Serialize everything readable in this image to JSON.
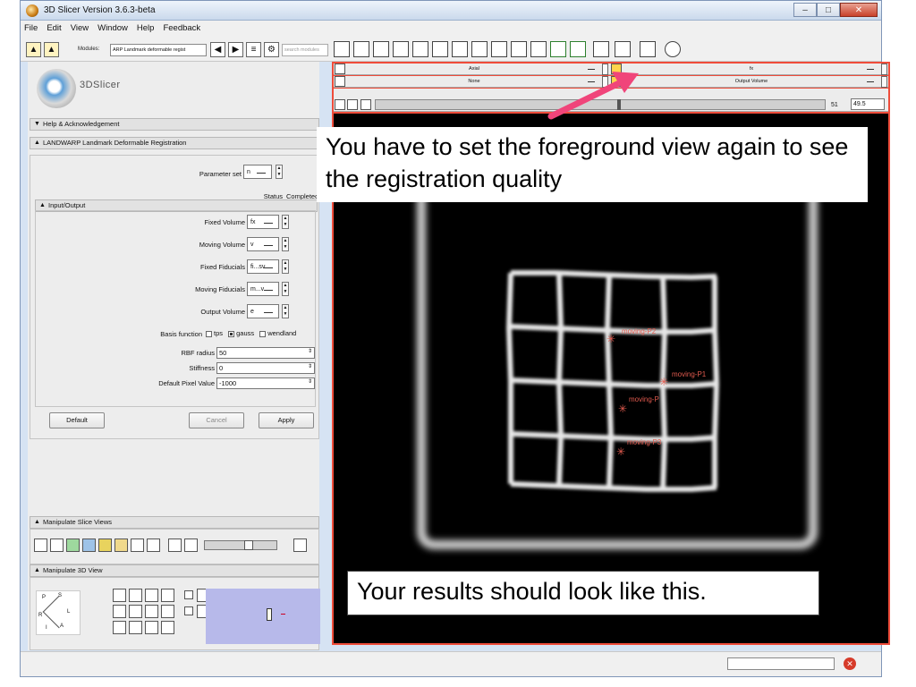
{
  "window": {
    "title": "3D Slicer Version 3.6.3-beta"
  },
  "menu": [
    "File",
    "Edit",
    "View",
    "Window",
    "Help",
    "Feedback"
  ],
  "toolbar": {
    "modules_label": "Modules:",
    "module_value": "ARP Landmark deformable regist",
    "search_placeholder": "search modules"
  },
  "logo": {
    "text": "3DSlicer"
  },
  "sections": {
    "help": "Help & Acknowledgement",
    "module": "LANDWARP Landmark Deformable Registration",
    "io": "Input/Output",
    "slice_views": "Manipulate Slice Views",
    "view3d": "Manipulate 3D View"
  },
  "module": {
    "parameter_set_label": "Parameter set",
    "parameter_set_value": "n",
    "status_label": "Status",
    "status_value": "Completed",
    "fixed_volume_label": "Fixed Volume",
    "fixed_volume_value": "fx",
    "moving_volume_label": "Moving Volume",
    "moving_volume_value": "v",
    "fixed_fiducials_label": "Fixed Fiducials",
    "fixed_fiducials_value": "fi...sv",
    "moving_fiducials_label": "Moving Fiducials",
    "moving_fiducials_value": "m...v",
    "output_volume_label": "Output Volume",
    "output_volume_value": "e",
    "basis_label": "Basis function",
    "basis_options": [
      "tps",
      "gauss",
      "wendland"
    ],
    "basis_selected": "gauss",
    "rbf_label": "RBF radius",
    "rbf_value": "50",
    "stiffness_label": "Stiffness",
    "stiffness_value": "0",
    "default_pixel_label": "Default Pixel Value",
    "default_pixel_value": "-1000",
    "btn_default": "Default",
    "btn_cancel": "Cancel",
    "btn_apply": "Apply"
  },
  "viewer": {
    "orientation": "Axial",
    "foreground_left": "None",
    "background_right": "fx",
    "foreground_right": "Output Volume",
    "slice_index": "51",
    "slice_offset": "49.5"
  },
  "annotations": {
    "top": "You have to set the foreground view again to see the registration quality",
    "bottom": "Your results should look like this."
  },
  "fiducials": [
    {
      "label": "moving-P2"
    },
    {
      "label": "moving-P1"
    },
    {
      "label": "moving-P"
    },
    {
      "label": "moving-P3"
    }
  ],
  "colors": {
    "viewer_frame": "#ef4c3a",
    "arrow": "#f0457a",
    "fiducial": "#e25b4f",
    "preview_bg": "#b7b9ea"
  }
}
